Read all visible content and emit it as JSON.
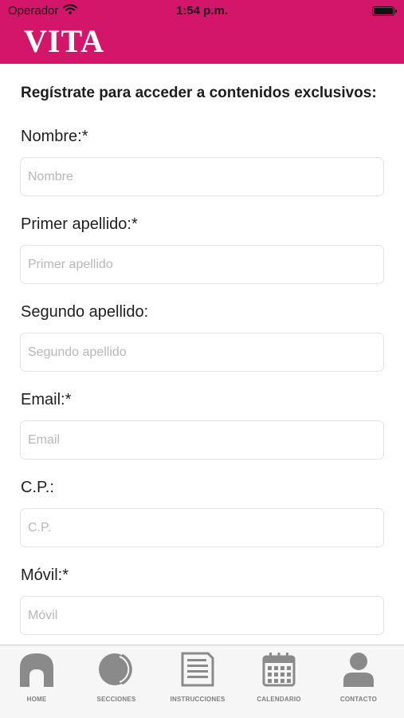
{
  "status_bar": {
    "carrier": "Operador",
    "time": "1:54 p.m."
  },
  "header": {
    "brand": "VITA",
    "brand_color": "#d3166a"
  },
  "form": {
    "intro": "Regístrate para acceder a contenidos exclusivos:",
    "fields": [
      {
        "label": "Nombre:*",
        "placeholder": "Nombre",
        "value": ""
      },
      {
        "label": "Primer apellido:*",
        "placeholder": "Primer apellido",
        "value": ""
      },
      {
        "label": "Segundo apellido:",
        "placeholder": "Segundo apellido",
        "value": ""
      },
      {
        "label": "Email:*",
        "placeholder": "Email",
        "value": ""
      },
      {
        "label": "C.P.:",
        "placeholder": "C.P.",
        "value": ""
      },
      {
        "label": "Móvil:*",
        "placeholder": "Móvil",
        "value": ""
      }
    ]
  },
  "tab_bar": {
    "items": [
      {
        "label": "HOME",
        "icon": "home-icon"
      },
      {
        "label": "SECCIONES",
        "icon": "sections-icon"
      },
      {
        "label": "INSTRUCCIONES",
        "icon": "document-icon"
      },
      {
        "label": "CALENDARIO",
        "icon": "calendar-icon"
      },
      {
        "label": "CONTACTO",
        "icon": "person-icon"
      }
    ],
    "icon_color": "#8a8a8a"
  }
}
